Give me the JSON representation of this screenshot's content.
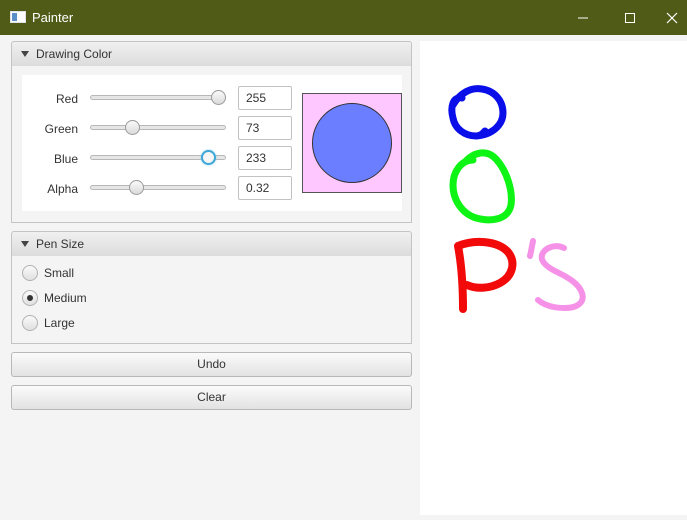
{
  "window": {
    "title": "Painter"
  },
  "drawing_color": {
    "title": "Drawing Color",
    "rows": [
      {
        "label": "Red",
        "value": "255",
        "level": 1.0
      },
      {
        "label": "Green",
        "value": "73",
        "level": 0.286
      },
      {
        "label": "Blue",
        "value": "233",
        "level": 0.914
      },
      {
        "label": "Alpha",
        "value": "0.32",
        "level": 0.32
      }
    ],
    "swatch_background": "#ffc7ff",
    "swatch_color": "#6a7eff"
  },
  "pen_size": {
    "title": "Pen Size",
    "options": [
      {
        "label": "Small",
        "selected": false
      },
      {
        "label": "Medium",
        "selected": true
      },
      {
        "label": "Large",
        "selected": false
      }
    ]
  },
  "buttons": {
    "undo": "Undo",
    "clear": "Clear"
  },
  "canvas": {
    "strokes": [
      {
        "name": "blue-o-stroke",
        "color": "#0a0ee8"
      },
      {
        "name": "green-o-stroke",
        "color": "#0ef414"
      },
      {
        "name": "red-p-stroke",
        "color": "#f20a0a"
      },
      {
        "name": "pink-apostrophe-stroke",
        "color": "#f277e2"
      },
      {
        "name": "pink-s-stroke",
        "color": "#f277e2"
      }
    ]
  }
}
